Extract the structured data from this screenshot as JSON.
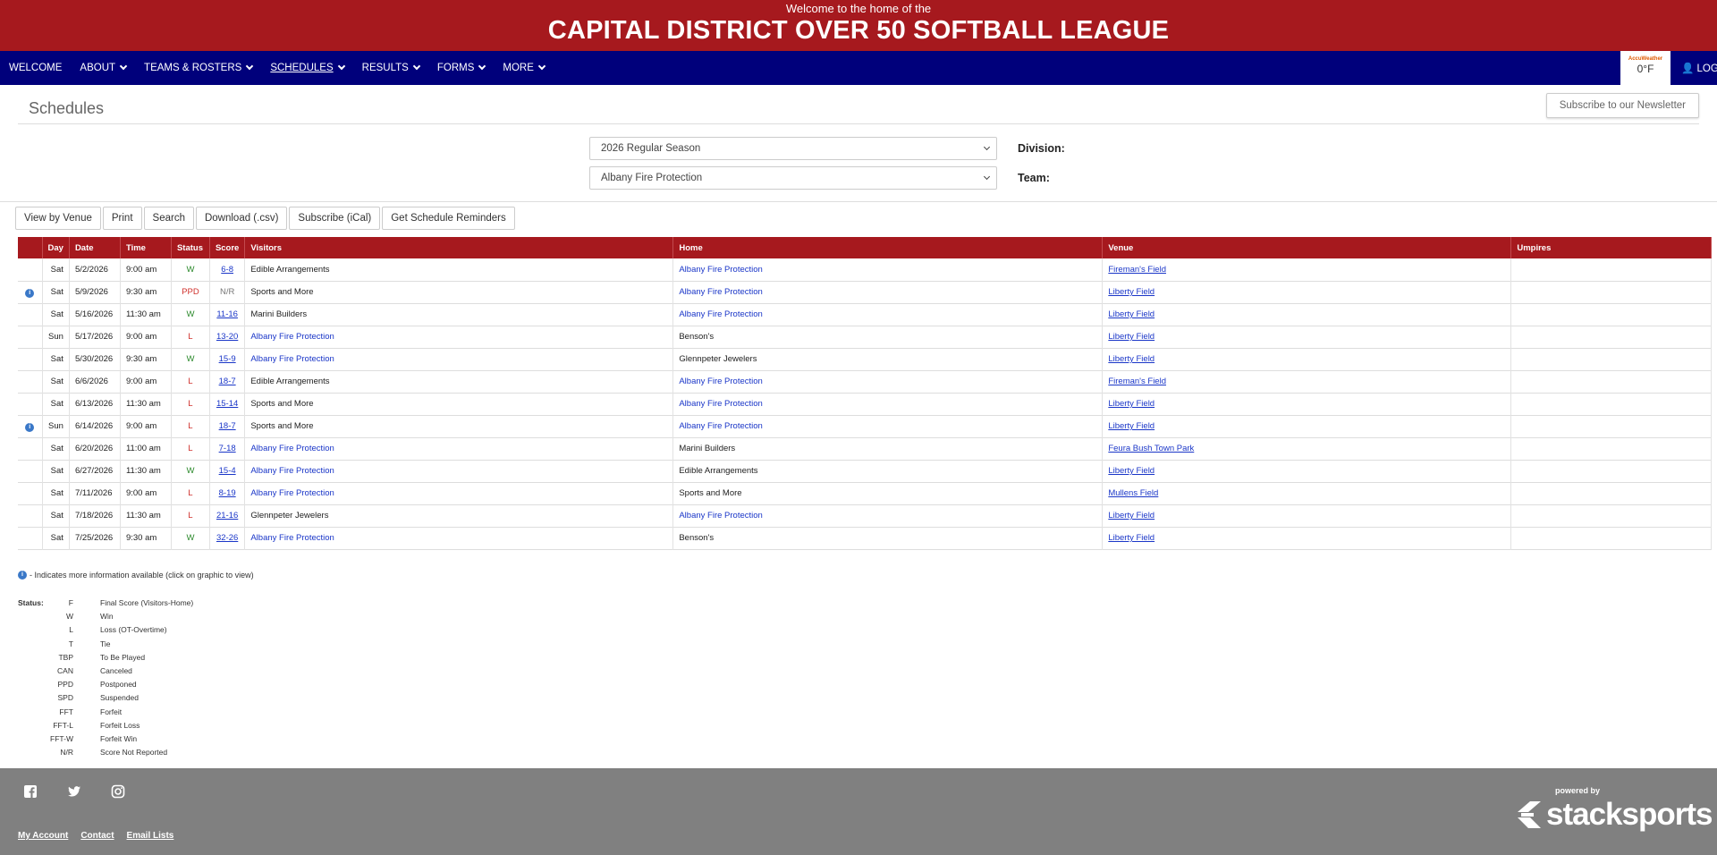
{
  "banner": {
    "subtitle": "Welcome to the home of the",
    "title": "CAPITAL DISTRICT OVER 50 SOFTBALL LEAGUE"
  },
  "nav": {
    "items": [
      {
        "label": "WELCOME",
        "caret": false,
        "active": false
      },
      {
        "label": "ABOUT",
        "caret": true,
        "active": false
      },
      {
        "label": "TEAMS & ROSTERS",
        "caret": true,
        "active": false
      },
      {
        "label": "SCHEDULES",
        "caret": true,
        "active": true
      },
      {
        "label": "RESULTS",
        "caret": true,
        "active": false
      },
      {
        "label": "FORMS",
        "caret": true,
        "active": false
      },
      {
        "label": "MORE",
        "caret": true,
        "active": false
      }
    ],
    "weather": {
      "brand": "AccuWeather",
      "temp": "0°F"
    },
    "login": "LOGIN"
  },
  "page": {
    "title": "Schedules",
    "newsletter": "Subscribe to our Newsletter"
  },
  "filters": {
    "season": "2026 Regular Season",
    "team": "Albany Fire Protection",
    "division_label": "Division:",
    "team_label": "Team:"
  },
  "buttons": [
    "View by Venue",
    "Print",
    "Search",
    "Download (.csv)",
    "Subscribe (iCal)",
    "Get Schedule Reminders"
  ],
  "table": {
    "headers": [
      "",
      "Day",
      "Date",
      "Time",
      "Status",
      "Score",
      "Visitors",
      "Home",
      "Venue",
      "Umpires"
    ],
    "rows": [
      {
        "info": false,
        "day": "Sat",
        "date": "5/2/2026",
        "time": "9:00 am",
        "status": "W",
        "score": "6-8",
        "visitors": "Edible Arrangements",
        "visitors_link": false,
        "home": "Albany Fire Protection",
        "home_link": true,
        "venue": "Fireman's Field",
        "umpires": ""
      },
      {
        "info": true,
        "day": "Sat",
        "date": "5/9/2026",
        "time": "9:30 am",
        "status": "PPD",
        "score": "N/R",
        "visitors": "Sports and More",
        "visitors_link": false,
        "home": "Albany Fire Protection",
        "home_link": true,
        "venue": "Liberty Field",
        "umpires": ""
      },
      {
        "info": false,
        "day": "Sat",
        "date": "5/16/2026",
        "time": "11:30 am",
        "status": "W",
        "score": "11-16",
        "visitors": "Marini Builders",
        "visitors_link": false,
        "home": "Albany Fire Protection",
        "home_link": true,
        "venue": "Liberty Field",
        "umpires": ""
      },
      {
        "info": false,
        "day": "Sun",
        "date": "5/17/2026",
        "time": "9:00 am",
        "status": "L",
        "score": "13-20",
        "visitors": "Albany Fire Protection",
        "visitors_link": true,
        "home": "Benson's",
        "home_link": false,
        "venue": "Liberty Field",
        "umpires": ""
      },
      {
        "info": false,
        "day": "Sat",
        "date": "5/30/2026",
        "time": "9:30 am",
        "status": "W",
        "score": "15-9",
        "visitors": "Albany Fire Protection",
        "visitors_link": true,
        "home": "Glennpeter Jewelers",
        "home_link": false,
        "venue": "Liberty Field",
        "umpires": ""
      },
      {
        "info": false,
        "day": "Sat",
        "date": "6/6/2026",
        "time": "9:00 am",
        "status": "L",
        "score": "18-7",
        "visitors": "Edible Arrangements",
        "visitors_link": false,
        "home": "Albany Fire Protection",
        "home_link": true,
        "venue": "Fireman's Field",
        "umpires": ""
      },
      {
        "info": false,
        "day": "Sat",
        "date": "6/13/2026",
        "time": "11:30 am",
        "status": "L",
        "score": "15-14",
        "visitors": "Sports and More",
        "visitors_link": false,
        "home": "Albany Fire Protection",
        "home_link": true,
        "venue": "Liberty Field",
        "umpires": ""
      },
      {
        "info": true,
        "day": "Sun",
        "date": "6/14/2026",
        "time": "9:00 am",
        "status": "L",
        "score": "18-7",
        "visitors": "Sports and More",
        "visitors_link": false,
        "home": "Albany Fire Protection",
        "home_link": true,
        "venue": "Liberty Field",
        "umpires": ""
      },
      {
        "info": false,
        "day": "Sat",
        "date": "6/20/2026",
        "time": "11:00 am",
        "status": "L",
        "score": "7-18",
        "visitors": "Albany Fire Protection",
        "visitors_link": true,
        "home": "Marini Builders",
        "home_link": false,
        "venue": "Feura Bush Town Park",
        "umpires": ""
      },
      {
        "info": false,
        "day": "Sat",
        "date": "6/27/2026",
        "time": "11:30 am",
        "status": "W",
        "score": "15-4",
        "visitors": "Albany Fire Protection",
        "visitors_link": true,
        "home": "Edible Arrangements",
        "home_link": false,
        "venue": "Liberty Field",
        "umpires": ""
      },
      {
        "info": false,
        "day": "Sat",
        "date": "7/11/2026",
        "time": "9:00 am",
        "status": "L",
        "score": "8-19",
        "visitors": "Albany Fire Protection",
        "visitors_link": true,
        "home": "Sports and More",
        "home_link": false,
        "venue": "Mullens Field",
        "umpires": ""
      },
      {
        "info": false,
        "day": "Sat",
        "date": "7/18/2026",
        "time": "11:30 am",
        "status": "L",
        "score": "21-16",
        "visitors": "Glennpeter Jewelers",
        "visitors_link": false,
        "home": "Albany Fire Protection",
        "home_link": true,
        "venue": "Liberty Field",
        "umpires": ""
      },
      {
        "info": false,
        "day": "Sat",
        "date": "7/25/2026",
        "time": "9:30 am",
        "status": "W",
        "score": "32-26",
        "visitors": "Albany Fire Protection",
        "visitors_link": true,
        "home": "Benson's",
        "home_link": false,
        "venue": "Liberty Field",
        "umpires": ""
      }
    ]
  },
  "info_note": "- Indicates more information available (click on graphic to view)",
  "legend": {
    "title": "Status:",
    "items": [
      {
        "code": "F",
        "desc": "Final Score (Visitors-Home)"
      },
      {
        "code": "W",
        "desc": "Win"
      },
      {
        "code": "L",
        "desc": "Loss (OT-Overtime)"
      },
      {
        "code": "T",
        "desc": "Tie"
      },
      {
        "code": "TBP",
        "desc": "To Be Played"
      },
      {
        "code": "CAN",
        "desc": "Canceled"
      },
      {
        "code": "PPD",
        "desc": "Postponed"
      },
      {
        "code": "SPD",
        "desc": "Suspended"
      },
      {
        "code": "FFT",
        "desc": "Forfeit"
      },
      {
        "code": "FFT-L",
        "desc": "Forfeit Loss"
      },
      {
        "code": "FFT-W",
        "desc": "Forfeit Win"
      },
      {
        "code": "N/R",
        "desc": "Score Not Reported"
      }
    ]
  },
  "footer": {
    "links": [
      "My Account",
      "Contact",
      "Email Lists"
    ],
    "powered": "powered by",
    "brand": "stacksports",
    "social": [
      "facebook-icon",
      "twitter-icon",
      "instagram-icon"
    ]
  },
  "colors": {
    "banner": "#a6191e",
    "nav": "#00007b",
    "footer": "#808080",
    "win": "#2d8a2d",
    "loss": "#d0312d",
    "link": "#1a36c8"
  }
}
